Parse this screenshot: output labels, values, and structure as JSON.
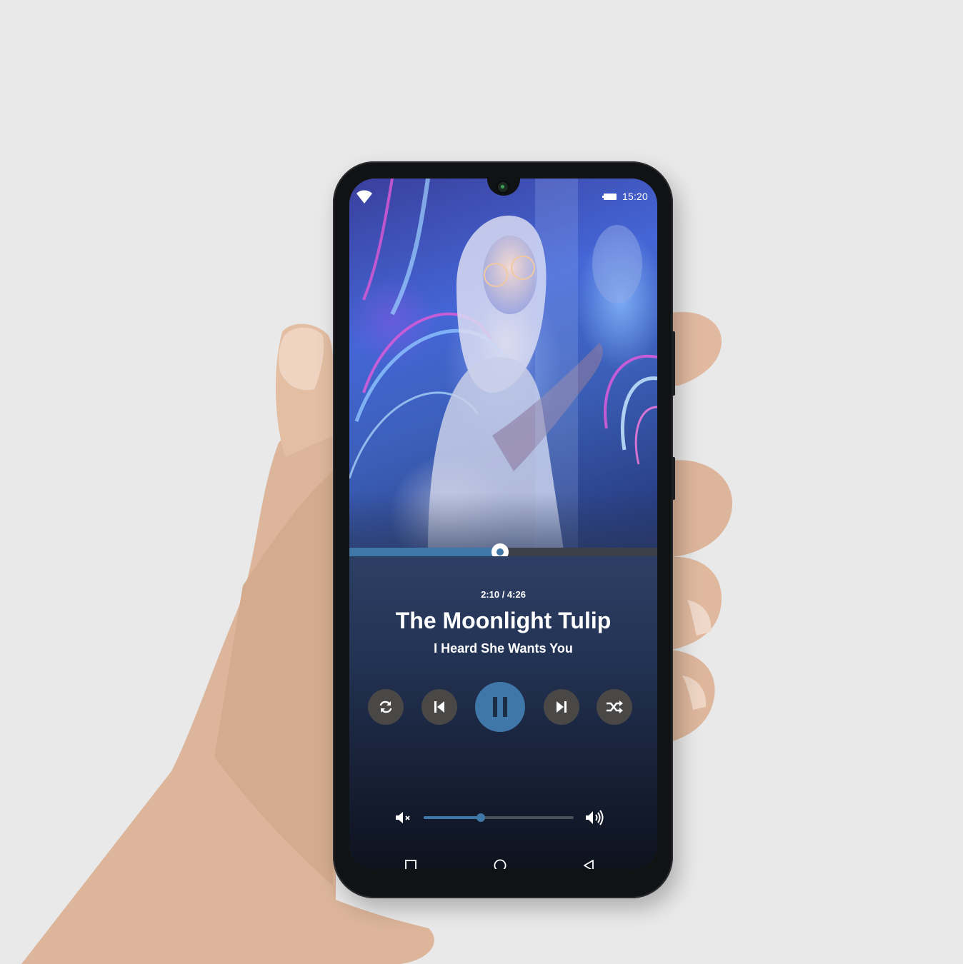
{
  "status_bar": {
    "time": "15:20",
    "wifi_icon": "wifi-icon",
    "battery_icon": "battery-icon"
  },
  "player": {
    "elapsed": "2:10",
    "duration": "4:26",
    "time_display": "2:10 / 4:26",
    "progress_fraction": 0.49,
    "track_title": "The Moonlight Tulip",
    "artist": "I Heard She Wants You",
    "volume_fraction": 0.38,
    "accent_color": "#3f78a8",
    "controls": {
      "repeat_icon": "repeat-icon",
      "previous_icon": "skip-previous-icon",
      "play_pause_icon": "pause-icon",
      "next_icon": "skip-next-icon",
      "shuffle_icon": "shuffle-icon",
      "mute_icon": "volume-mute-icon",
      "volume_max_icon": "volume-up-icon"
    }
  },
  "navigation": {
    "recents_icon": "square-icon",
    "home_icon": "circle-icon",
    "back_icon": "triangle-back-icon"
  }
}
